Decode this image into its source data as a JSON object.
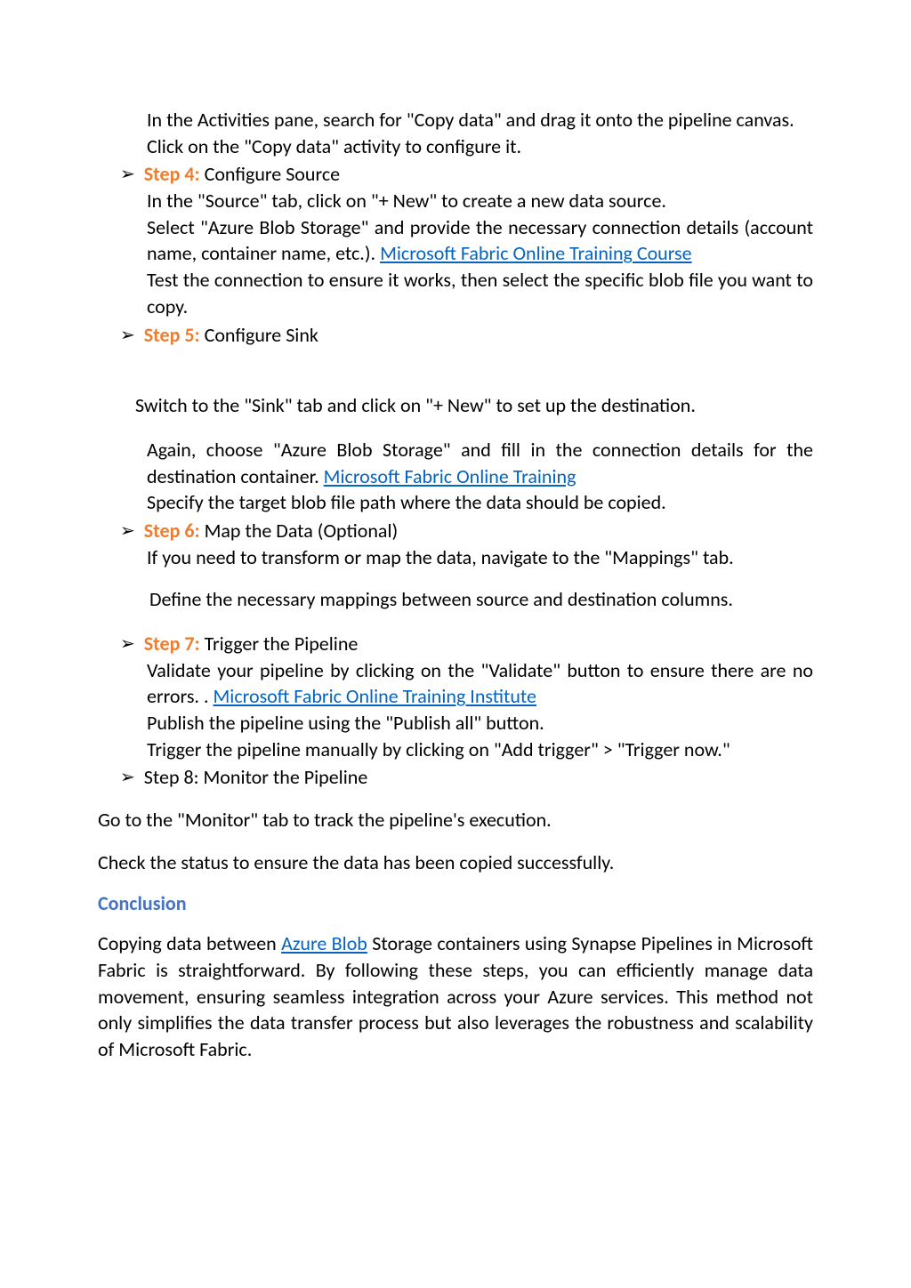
{
  "intro": {
    "line1": "In the Activities pane, search for \"Copy data\" and drag it onto the pipeline canvas.",
    "line2": "Click on the \"Copy data\" activity to configure it."
  },
  "step4": {
    "label": "Step 4:",
    "title": " Configure Source",
    "body1": "In the \"Source\" tab, click on \"+ New\" to create a new data source.",
    "body2a": "Select \"Azure Blob Storage\" and provide the necessary connection details (account name, container name, etc.). ",
    "link": "Microsoft Fabric Online Training Course",
    "body3": "Test the connection to ensure it works, then select the specific blob file you want to copy."
  },
  "step5": {
    "label": "Step 5:",
    "title": " Configure Sink",
    "body1": "Switch to the \"Sink\" tab and click on \"+ New\" to set up the destination.",
    "body2a": "Again, choose \"Azure Blob Storage\" and fill in the connection details for the destination container.   ",
    "link": "Microsoft Fabric Online Training",
    "body3": "Specify the target blob file path where the data should be copied."
  },
  "step6": {
    "label": "Step 6:",
    "title": " Map the Data (Optional)",
    "body1": "If you need to transform or map the data, navigate to the \"Mappings\" tab.",
    "body2": "Define the necessary mappings between source and destination columns."
  },
  "step7": {
    "label": "Step 7:",
    "title": " Trigger the Pipeline",
    "body1": "Validate your pipeline by clicking on the \"Validate\" button to ensure there are no errors.      .   ",
    "link": "Microsoft Fabric Online Training Institute",
    "body2": "Publish the pipeline using the \"Publish all\" button.",
    "body3": "Trigger the pipeline manually by clicking on \"Add trigger\" > \"Trigger now.\""
  },
  "step8": {
    "label": "Step 8: Monitor the Pipeline",
    "body1": "Go to the \"Monitor\" tab to track the pipeline's execution.",
    "body2": "Check the status to ensure the data has been copied successfully."
  },
  "conclusion": {
    "heading": "Conclusion",
    "body1a": "Copying data between ",
    "link": "Azure Blob",
    "body1b": " Storage containers using Synapse Pipelines in Microsoft Fabric is straightforward. By following these steps, you can efficiently manage data movement, ensuring seamless integration across your Azure services. This method not only simplifies the data transfer process but also leverages the robustness and scalability of Microsoft Fabric."
  }
}
